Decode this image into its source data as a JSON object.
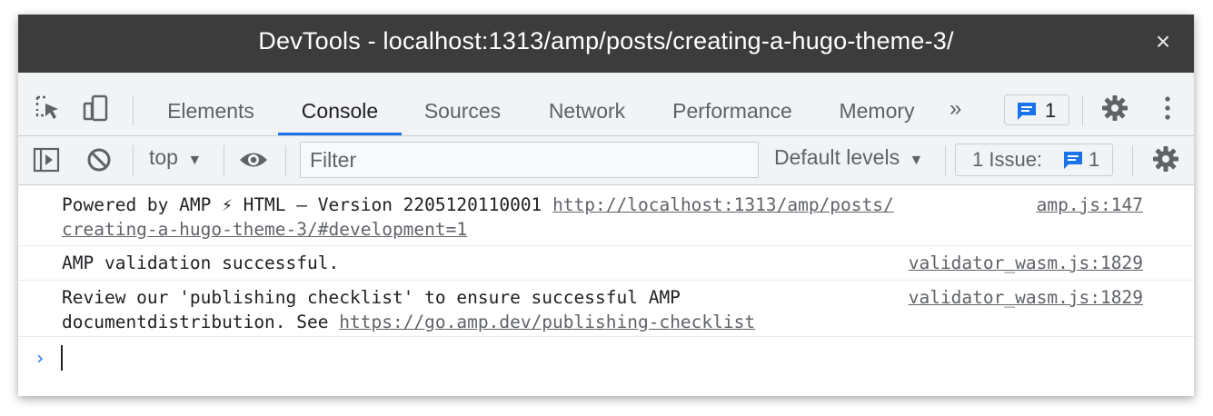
{
  "window": {
    "title": "DevTools - localhost:1313/amp/posts/creating-a-hugo-theme-3/",
    "close_glyph": "×"
  },
  "tabs": [
    {
      "label": "Elements",
      "active": false
    },
    {
      "label": "Console",
      "active": true
    },
    {
      "label": "Sources",
      "active": false
    },
    {
      "label": "Network",
      "active": false
    },
    {
      "label": "Performance",
      "active": false
    },
    {
      "label": "Memory",
      "active": false
    }
  ],
  "tabbar": {
    "more_glyph": "»",
    "message_count": "1",
    "icons": [
      "inspect-element-icon",
      "device-toolbar-icon",
      "chat-icon",
      "gear-icon",
      "more-vert-icon"
    ]
  },
  "toolbar": {
    "context": "top",
    "filter_placeholder": "Filter",
    "levels": "Default levels",
    "issues_label": "1 Issue:",
    "issues_count": "1",
    "icons": [
      "sidebar-toggle-icon",
      "clear-console-icon",
      "eye-icon",
      "chat-icon",
      "gear-icon"
    ]
  },
  "console": {
    "messages": [
      {
        "text": "Powered by AMP ⚡ HTML – Version 2205120110001",
        "link_line1": "http://localhost:1313/amp/posts/",
        "link_line2": "creating-a-hugo-theme-3/#development=1",
        "source": "amp.js:147"
      },
      {
        "text": "AMP validation successful.",
        "source": "validator_wasm.js:1829"
      },
      {
        "text": "Review our 'publishing checklist' to ensure successful AMP",
        "text_line2": "documentdistribution. See",
        "link": "https://go.amp.dev/publishing-checklist",
        "source": "validator_wasm.js:1829"
      }
    ],
    "prompt_glyph": "›"
  },
  "colors": {
    "accent": "#1a73e8",
    "titlebar": "#3c3c3c",
    "toolbar_bg": "#f1f3f4"
  }
}
